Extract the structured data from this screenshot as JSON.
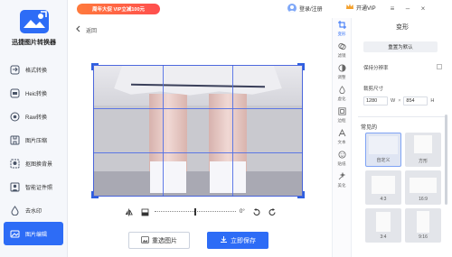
{
  "app": {
    "name": "迅捷图片转换器"
  },
  "sidebar": {
    "items": [
      {
        "label": "格式转换",
        "icon": "convert-icon"
      },
      {
        "label": "Heic转换",
        "icon": "heic-icon"
      },
      {
        "label": "Raw转换",
        "icon": "raw-icon"
      },
      {
        "label": "图片压缩",
        "icon": "compress-icon"
      },
      {
        "label": "抠图换背景",
        "icon": "cutout-icon"
      },
      {
        "label": "智能证件照",
        "icon": "id-photo-icon"
      },
      {
        "label": "去水印",
        "icon": "watermark-icon"
      },
      {
        "label": "图片编辑",
        "icon": "edit-icon",
        "active": true
      }
    ]
  },
  "topbar": {
    "promo": "周年大促 VIP立减100元",
    "login": "登录/注册",
    "vip": "开通VIP"
  },
  "editor": {
    "back_label": "返回",
    "rotation": "0°",
    "reselect_label": "重选图片",
    "save_label": "立即保存"
  },
  "tools": [
    {
      "label": "变形",
      "icon": "transform-icon",
      "active": true
    },
    {
      "label": "滤镜",
      "icon": "filter-icon"
    },
    {
      "label": "调整",
      "icon": "adjust-icon"
    },
    {
      "label": "虚化",
      "icon": "blur-icon"
    },
    {
      "label": "边框",
      "icon": "border-icon"
    },
    {
      "label": "文本",
      "icon": "text-icon"
    },
    {
      "label": "贴纸",
      "icon": "sticker-icon"
    },
    {
      "label": "美化",
      "icon": "beautify-icon"
    }
  ],
  "panel": {
    "title": "变形",
    "reset": "重置为默认",
    "keep_ratio": "保持分辨率",
    "size_label": "裁剪尺寸",
    "width": "1280",
    "height": "854",
    "unit_w": "W",
    "unit_h": "H",
    "common_label": "常见的",
    "presets": [
      {
        "label": "自定义",
        "selected": true
      },
      {
        "label": "方形"
      },
      {
        "label": "4:3"
      },
      {
        "label": "16:9"
      },
      {
        "label": "3:4"
      },
      {
        "label": "9:16"
      }
    ]
  },
  "colors": {
    "accent": "#2d6cf6",
    "promo": "#ff5a45"
  }
}
